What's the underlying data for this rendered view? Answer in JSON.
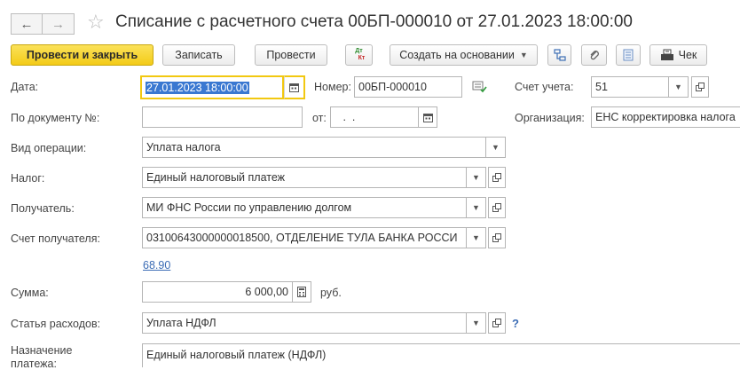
{
  "window": {
    "title": "Списание с расчетного счета 00БП-000010 от 27.01.2023 18:00:00"
  },
  "toolbar": {
    "post_close_label": "Провести и закрыть",
    "save_label": "Записать",
    "post_label": "Провести",
    "dtkt_top": "Дт",
    "dtkt_bottom": "Кт",
    "create_based_label": "Создать на основании",
    "check_label": "Чек"
  },
  "form": {
    "date": {
      "label": "Дата:",
      "value": "27.01.2023 18:00:00"
    },
    "number": {
      "label": "Номер:",
      "value": "00БП-000010"
    },
    "account": {
      "label": "Счет учета:",
      "value": "51"
    },
    "doc_number": {
      "label": "По документу №:",
      "value": ""
    },
    "doc_from": {
      "label": "от:",
      "value": " .  ."
    },
    "organization": {
      "label": "Организация:",
      "value": "ЕНС корректировка налога"
    },
    "operation_type": {
      "label": "Вид операции:",
      "value": "Уплата налога"
    },
    "tax": {
      "label": "Налог:",
      "value": "Единый налоговый платеж"
    },
    "recipient": {
      "label": "Получатель:",
      "value": "МИ ФНС России по управлению долгом"
    },
    "recipient_account": {
      "label": "Счет получателя:",
      "value": "03100643000000018500, ОТДЕЛЕНИЕ ТУЛА БАНКА РОССИ"
    },
    "link_value": "68.90",
    "amount": {
      "label": "Сумма:",
      "value": "6 000,00",
      "unit": "руб."
    },
    "expense_item": {
      "label": "Статья расходов:",
      "value": "Уплата НДФЛ",
      "help": "?"
    },
    "purpose": {
      "label_line1": "Назначение",
      "label_line2": "платежа:",
      "value": "Единый налоговый платеж (НДФЛ)"
    }
  },
  "colors": {
    "primary_button": "#f3cb17",
    "focus_border": "#f2c811",
    "selection": "#3a78d1",
    "link": "#3b6cb5"
  }
}
